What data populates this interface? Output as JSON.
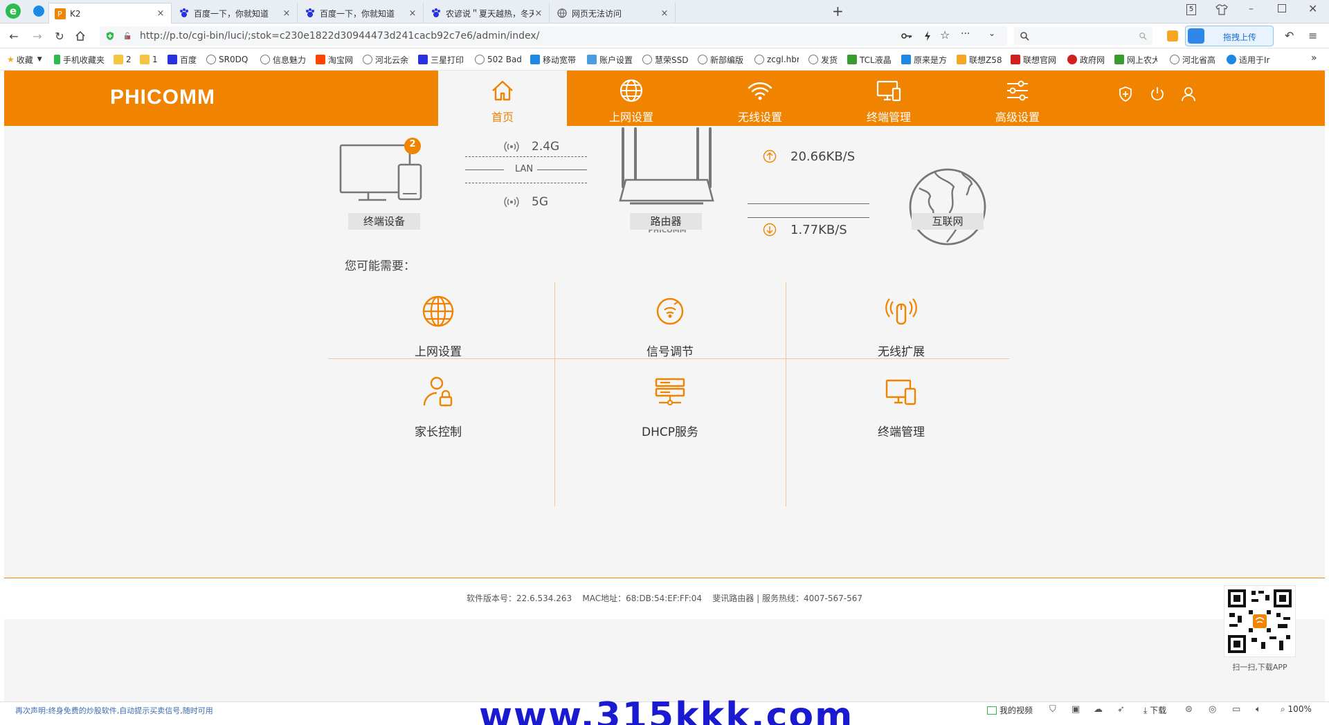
{
  "browser": {
    "tabs": [
      {
        "title": "K2",
        "close": "×",
        "active": true
      },
      {
        "title": "百度一下，你就知道",
        "close": "×"
      },
      {
        "title": "百度一下，你就知道",
        "close": "×"
      },
      {
        "title": "农谚说＂夏天越热，冬天越冷",
        "close": "×"
      },
      {
        "title": "网页无法访问",
        "close": "×"
      }
    ],
    "new_tab": "+",
    "badge_num": "5",
    "url": "http://p.to/cgi-bin/luci/;stok=c230e1822d30944473d241cacb92c7e6/admin/index/",
    "upload_label": "拖拽上传",
    "bookmarks": [
      "收藏",
      "手机收藏夹",
      "2",
      "1",
      "百度",
      "SR0DQ",
      "信息魅力",
      "淘宝网",
      "河北云余",
      "三星打印",
      "502 Bad",
      "移动宽带",
      "账户设置",
      "慧荣SSD",
      "新部编版",
      "zcgl.hbr",
      "发货",
      "TCL液晶",
      "原来是方",
      "联想Z58",
      "联想官网",
      "政府网",
      "网上农大",
      "河北省高",
      "适用于Ir"
    ],
    "more": "»"
  },
  "router": {
    "logo": "PHICOMM",
    "nav": [
      "首页",
      "上网设置",
      "无线设置",
      "终端管理",
      "高级设置"
    ],
    "diagram": {
      "device_count": "2",
      "band_24": "2.4G",
      "lan": "LAN",
      "band_5": "5G",
      "router_brand": "PHICOMM",
      "upload_speed": "20.66KB/S",
      "download_speed": "1.77KB/S",
      "captions": [
        "终端设备",
        "路由器",
        "互联网"
      ]
    },
    "suggest_title": "您可能需要：",
    "quick": [
      "上网设置",
      "信号调节",
      "无线扩展",
      "家长控制",
      "DHCP服务",
      "终端管理"
    ],
    "footer": {
      "info": "软件版本号：22.6.534.263    MAC地址：68:DB:54:EF:FF:04    斐讯路由器 | 服务热线：4007-567-567",
      "qr_caption": "扫一扫,下载APP"
    }
  },
  "statusbar": {
    "notice": "再次声明:终身免费的炒股软件,自动提示买卖信号,随时可用",
    "watermark": "www.315kkk.com",
    "my_video": "我的视频",
    "download": "下载",
    "zoom": "100%"
  },
  "colors": {
    "accent": "#f08300",
    "watermark": "#1a1ad0"
  }
}
